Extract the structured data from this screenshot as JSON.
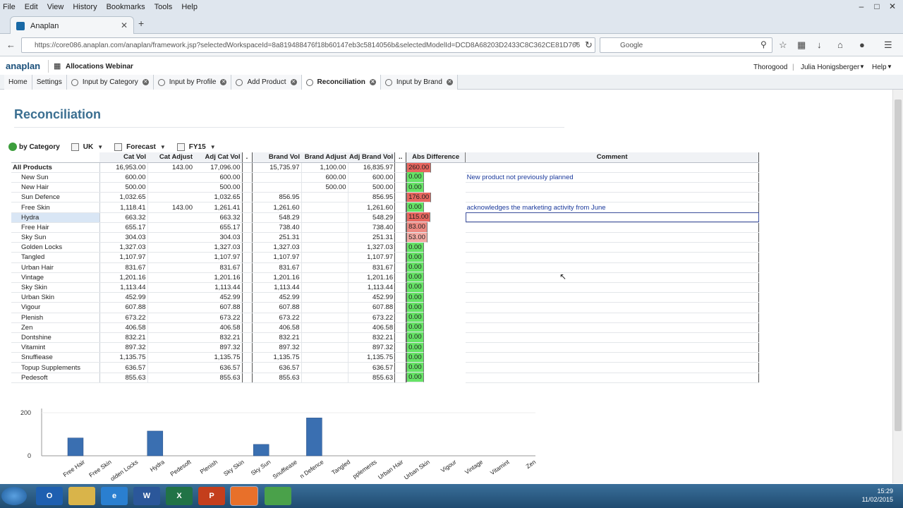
{
  "browser": {
    "menu": [
      "File",
      "Edit",
      "View",
      "History",
      "Bookmarks",
      "Tools",
      "Help"
    ],
    "tab_title": "Anaplan",
    "url": "https://core086.anaplan.com/anaplan/framework.jsp?selectedWorkspaceId=8a819488476f18b60147eb3c5814056b&selectedModelId=DCD8A68203D2433C8C362CE81D766",
    "search_placeholder": "Google"
  },
  "app": {
    "logo": "anaplan",
    "model_name": "Allocations Webinar",
    "org": "Thorogood",
    "user": "Julia Honigsberger",
    "help": "Help",
    "tabs": [
      {
        "label": "Home",
        "closable": false,
        "icon": false
      },
      {
        "label": "Settings",
        "closable": false,
        "icon": false
      },
      {
        "label": "Input by Category",
        "closable": true,
        "icon": true
      },
      {
        "label": "Input by Profile",
        "closable": true,
        "icon": true
      },
      {
        "label": "Add Product",
        "closable": true,
        "icon": true
      },
      {
        "label": "Reconciliation",
        "closable": true,
        "icon": true,
        "active": true
      },
      {
        "label": "Input by Brand",
        "closable": true,
        "icon": true
      }
    ]
  },
  "page": {
    "title": "Reconciliation",
    "context": {
      "dimension": "by Category",
      "region": "UK",
      "version": "Forecast",
      "period": "FY15"
    }
  },
  "grid": {
    "headers": [
      "Cat Vol",
      "Cat Adjust",
      "Adj Cat Vol",
      ".",
      "Brand Vol",
      "Brand Adjust",
      "Adj Brand Vol",
      "..",
      "Abs Difference",
      "Comment"
    ],
    "rows": [
      {
        "label": "All Products",
        "top": true,
        "cat_vol": "16,953.00",
        "cat_adj": "143.00",
        "adj_cat": "17,096.00",
        "brand_vol": "15,735.97",
        "brand_adj": "1,100.00",
        "adj_brand": "16,835.97",
        "abs": "260.00",
        "status": "red",
        "comment": ""
      },
      {
        "label": "New Sun",
        "cat_vol": "600.00",
        "cat_adj": "",
        "adj_cat": "600.00",
        "brand_vol": "",
        "brand_adj": "600.00",
        "adj_brand": "600.00",
        "abs": "0.00",
        "status": "green",
        "comment": "New product not previously planned"
      },
      {
        "label": "New Hair",
        "cat_vol": "500.00",
        "cat_adj": "",
        "adj_cat": "500.00",
        "brand_vol": "",
        "brand_adj": "500.00",
        "adj_brand": "500.00",
        "abs": "0.00",
        "status": "green",
        "comment": ""
      },
      {
        "label": "Sun Defence",
        "cat_vol": "1,032.65",
        "cat_adj": "",
        "adj_cat": "1,032.65",
        "brand_vol": "856.95",
        "brand_adj": "",
        "adj_brand": "856.95",
        "abs": "176.00",
        "status": "red",
        "comment": ""
      },
      {
        "label": "Free Skin",
        "cat_vol": "1,118.41",
        "cat_adj": "143.00",
        "adj_cat": "1,261.41",
        "brand_vol": "1,261.60",
        "brand_adj": "",
        "adj_brand": "1,261.60",
        "abs": "0.00",
        "status": "green",
        "comment": "acknowledges the marketing activity from June"
      },
      {
        "label": "Hydra",
        "sel": true,
        "cat_vol": "663.32",
        "cat_adj": "",
        "adj_cat": "663.32",
        "brand_vol": "548.29",
        "brand_adj": "",
        "adj_brand": "548.29",
        "abs": "115.00",
        "status": "red",
        "comment": ""
      },
      {
        "label": "Free Hair",
        "cat_vol": "655.17",
        "cat_adj": "",
        "adj_cat": "655.17",
        "brand_vol": "738.40",
        "brand_adj": "",
        "adj_brand": "738.40",
        "abs": "83.00",
        "status": "lightred",
        "comment": ""
      },
      {
        "label": "Sky Sun",
        "cat_vol": "304.03",
        "cat_adj": "",
        "adj_cat": "304.03",
        "brand_vol": "251.31",
        "brand_adj": "",
        "adj_brand": "251.31",
        "abs": "53.00",
        "status": "pink",
        "comment": ""
      },
      {
        "label": "Golden Locks",
        "cat_vol": "1,327.03",
        "cat_adj": "",
        "adj_cat": "1,327.03",
        "brand_vol": "1,327.03",
        "brand_adj": "",
        "adj_brand": "1,327.03",
        "abs": "0.00",
        "status": "green",
        "comment": ""
      },
      {
        "label": "Tangled",
        "cat_vol": "1,107.97",
        "cat_adj": "",
        "adj_cat": "1,107.97",
        "brand_vol": "1,107.97",
        "brand_adj": "",
        "adj_brand": "1,107.97",
        "abs": "0.00",
        "status": "green",
        "comment": ""
      },
      {
        "label": "Urban Hair",
        "cat_vol": "831.67",
        "cat_adj": "",
        "adj_cat": "831.67",
        "brand_vol": "831.67",
        "brand_adj": "",
        "adj_brand": "831.67",
        "abs": "0.00",
        "status": "green",
        "comment": ""
      },
      {
        "label": "Vintage",
        "cat_vol": "1,201.16",
        "cat_adj": "",
        "adj_cat": "1,201.16",
        "brand_vol": "1,201.16",
        "brand_adj": "",
        "adj_brand": "1,201.16",
        "abs": "0.00",
        "status": "green",
        "comment": ""
      },
      {
        "label": "Sky Skin",
        "cat_vol": "1,113.44",
        "cat_adj": "",
        "adj_cat": "1,113.44",
        "brand_vol": "1,113.44",
        "brand_adj": "",
        "adj_brand": "1,113.44",
        "abs": "0.00",
        "status": "green",
        "comment": ""
      },
      {
        "label": "Urban Skin",
        "cat_vol": "452.99",
        "cat_adj": "",
        "adj_cat": "452.99",
        "brand_vol": "452.99",
        "brand_adj": "",
        "adj_brand": "452.99",
        "abs": "0.00",
        "status": "green",
        "comment": ""
      },
      {
        "label": "Vigour",
        "cat_vol": "607.88",
        "cat_adj": "",
        "adj_cat": "607.88",
        "brand_vol": "607.88",
        "brand_adj": "",
        "adj_brand": "607.88",
        "abs": "0.00",
        "status": "green",
        "comment": ""
      },
      {
        "label": "Plenish",
        "cat_vol": "673.22",
        "cat_adj": "",
        "adj_cat": "673.22",
        "brand_vol": "673.22",
        "brand_adj": "",
        "adj_brand": "673.22",
        "abs": "0.00",
        "status": "green",
        "comment": ""
      },
      {
        "label": "Zen",
        "cat_vol": "406.58",
        "cat_adj": "",
        "adj_cat": "406.58",
        "brand_vol": "406.58",
        "brand_adj": "",
        "adj_brand": "406.58",
        "abs": "0.00",
        "status": "green",
        "comment": ""
      },
      {
        "label": "Dontshine",
        "cat_vol": "832.21",
        "cat_adj": "",
        "adj_cat": "832.21",
        "brand_vol": "832.21",
        "brand_adj": "",
        "adj_brand": "832.21",
        "abs": "0.00",
        "status": "green",
        "comment": ""
      },
      {
        "label": "Vitamint",
        "cat_vol": "897.32",
        "cat_adj": "",
        "adj_cat": "897.32",
        "brand_vol": "897.32",
        "brand_adj": "",
        "adj_brand": "897.32",
        "abs": "0.00",
        "status": "green",
        "comment": ""
      },
      {
        "label": "Snuffiease",
        "cat_vol": "1,135.75",
        "cat_adj": "",
        "adj_cat": "1,135.75",
        "brand_vol": "1,135.75",
        "brand_adj": "",
        "adj_brand": "1,135.75",
        "abs": "0.00",
        "status": "green",
        "comment": ""
      },
      {
        "label": "Topup Supplements",
        "cat_vol": "636.57",
        "cat_adj": "",
        "adj_cat": "636.57",
        "brand_vol": "636.57",
        "brand_adj": "",
        "adj_brand": "636.57",
        "abs": "0.00",
        "status": "green",
        "comment": ""
      },
      {
        "label": "Pedesoft",
        "cat_vol": "855.63",
        "cat_adj": "",
        "adj_cat": "855.63",
        "brand_vol": "855.63",
        "brand_adj": "",
        "adj_brand": "855.63",
        "abs": "0.00",
        "status": "green",
        "comment": ""
      }
    ]
  },
  "colors": {
    "red": "#e8665f",
    "lightred": "#ed8a83",
    "pink": "#f3aaa4",
    "green": "#66e366",
    "bar": "#3a6fb1"
  },
  "chart_data": {
    "type": "bar",
    "categories": [
      "Free Hair",
      "Free Skin",
      "Golden Locks",
      "Hydra",
      "Pedesoft",
      "Plenish",
      "Sky Skin",
      "Sky Sun",
      "Snuffiease",
      "Sun Defence",
      "Tangled",
      "Topup Supplements",
      "Urban Hair",
      "Urban Skin",
      "Vigour",
      "Vintage",
      "Vitamint",
      "Zen"
    ],
    "tick_labels": [
      "Free Hair",
      "Free Skin",
      "olden Locks",
      "Hydra",
      "Pedesoft",
      "Plenish",
      "Sky Skin",
      "Sky Sun",
      "Snuffiease",
      "n Defence",
      "Tangled",
      "pplements",
      "Urban Hair",
      "Urban Skin",
      "Vigour",
      "Vintage",
      "Vitamint",
      "Zen"
    ],
    "values": [
      83,
      0,
      0,
      115,
      0,
      0,
      0,
      53,
      0,
      176,
      0,
      0,
      0,
      0,
      0,
      0,
      0,
      0
    ],
    "yticks": [
      "200",
      "0"
    ],
    "ylim": [
      0,
      200
    ],
    "grid": false
  },
  "taskbar": {
    "time": "15:29",
    "date": "11/02/2015"
  }
}
